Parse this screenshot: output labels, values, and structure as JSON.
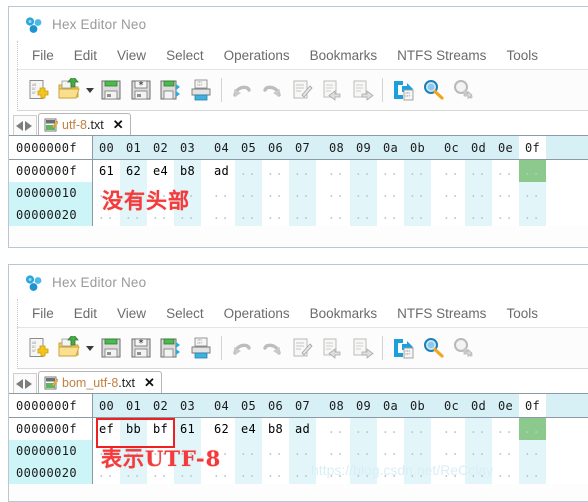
{
  "app": {
    "title": "Hex Editor Neo",
    "logo_icon": "molecule-logo-icon"
  },
  "menu": {
    "items": [
      {
        "label": "File"
      },
      {
        "label": "Edit"
      },
      {
        "label": "View"
      },
      {
        "label": "Select"
      },
      {
        "label": "Operations"
      },
      {
        "label": "Bookmarks"
      },
      {
        "label": "NTFS Streams"
      },
      {
        "label": "Tools"
      }
    ]
  },
  "toolbar": {
    "buttons": [
      {
        "icon": "new-file-icon",
        "label": "New"
      },
      {
        "icon": "open-folder-icon",
        "label": "Open"
      },
      {
        "icon": "open-dropdown-caret-icon",
        "label": "Open options"
      },
      {
        "icon": "save-icon",
        "label": "Save"
      },
      {
        "icon": "save-as-icon",
        "label": "Save As"
      },
      {
        "icon": "save-all-icon",
        "label": "Save All"
      },
      {
        "icon": "print-icon",
        "label": "Print"
      },
      {
        "icon": "undo-icon",
        "label": "Undo"
      },
      {
        "icon": "redo-icon",
        "label": "Redo"
      },
      {
        "icon": "cut-icon",
        "label": "Cut"
      },
      {
        "icon": "copy-icon",
        "label": "Copy"
      },
      {
        "icon": "paste-icon",
        "label": "Paste"
      },
      {
        "icon": "export-icon",
        "label": "Export"
      },
      {
        "icon": "find-icon",
        "label": "Find"
      },
      {
        "icon": "find-next-icon",
        "label": "Find Next"
      }
    ]
  },
  "hex_columns": [
    "00",
    "01",
    "02",
    "03",
    "04",
    "05",
    "06",
    "07",
    "08",
    "09",
    "0a",
    "0b",
    "0c",
    "0d",
    "0e",
    "0f"
  ],
  "selected_column": "0f",
  "panels": [
    {
      "nav": {
        "prev_icon": "nav-prev-icon",
        "next_icon": "nav-next-icon"
      },
      "tab": {
        "icon": "text-file-icon",
        "name": "utf-8",
        "ext": ".txt",
        "full": "utf-8.txt",
        "close_label": "✕"
      },
      "header_offset": "0000000f",
      "rows": [
        {
          "offset": "0000000f",
          "bytes": [
            "61",
            "62",
            "e4",
            "b8",
            "ad",
            "..",
            "..",
            "..",
            "..",
            "..",
            "..",
            "..",
            "..",
            "..",
            "..",
            ".."
          ],
          "green_index": 15
        },
        {
          "offset": "00000010",
          "bytes": [
            "..",
            "..",
            "..",
            "..",
            "..",
            "..",
            "..",
            "..",
            "..",
            "..",
            "..",
            "..",
            "..",
            "..",
            "..",
            ".."
          ],
          "green_index": -1
        },
        {
          "offset": "00000020",
          "bytes": [
            "..",
            "..",
            "..",
            "..",
            "..",
            "..",
            "..",
            "..",
            "..",
            "..",
            "..",
            "..",
            "..",
            "..",
            "..",
            ".."
          ],
          "green_index": -1
        }
      ],
      "annotation": {
        "text": "没有头部",
        "color": "#f43b3b"
      },
      "redbox": false
    },
    {
      "nav": {
        "prev_icon": "nav-prev-icon",
        "next_icon": "nav-next-icon"
      },
      "tab": {
        "icon": "text-file-icon",
        "name": "bom_utf-8",
        "ext": ".txt",
        "full": "bom_utf-8.txt",
        "close_label": "✕"
      },
      "header_offset": "0000000f",
      "rows": [
        {
          "offset": "0000000f",
          "bytes": [
            "ef",
            "bb",
            "bf",
            "61",
            "62",
            "e4",
            "b8",
            "ad",
            "..",
            "..",
            "..",
            "..",
            "..",
            "..",
            "..",
            ".."
          ],
          "green_index": 15
        },
        {
          "offset": "00000010",
          "bytes": [
            "..",
            "..",
            "..",
            "..",
            "..",
            "..",
            "..",
            "..",
            "..",
            "..",
            "..",
            "..",
            "..",
            "..",
            "..",
            ".."
          ],
          "green_index": -1
        },
        {
          "offset": "00000020",
          "bytes": [
            "..",
            "..",
            "..",
            "..",
            "..",
            "..",
            "..",
            "..",
            "..",
            "..",
            "..",
            "..",
            "..",
            "..",
            "..",
            ".."
          ],
          "green_index": -1
        }
      ],
      "annotation": {
        "text": "表示UTF-8",
        "color": "#f43b3b"
      },
      "redbox": true
    }
  ],
  "watermark": {
    "text": "https://blog.csdn.net/ReCclay"
  },
  "colors": {
    "accent_blue": "#29abe2",
    "column_tint": "#e2f6fa",
    "gutter_tint": "#cdf4f7",
    "selection_green": "#8cc98c",
    "annotation_red": "#f43b3b",
    "redbox_red": "#f02020"
  }
}
